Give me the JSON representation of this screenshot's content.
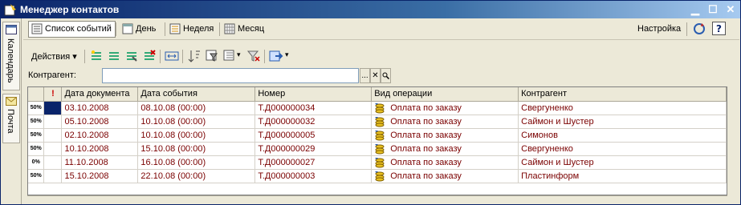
{
  "window": {
    "title": "Менеджер контактов"
  },
  "sidebar": {
    "tabs": [
      {
        "label": "Календарь"
      },
      {
        "label": "Почта"
      }
    ]
  },
  "toolbar": {
    "event_list": "Список событий",
    "day": "День",
    "week": "Неделя",
    "month": "Месяц",
    "settings": "Настройка"
  },
  "actions": {
    "label": "Действия"
  },
  "filter": {
    "label": "Контрагент:",
    "value": "",
    "select_btn": "...",
    "clear_btn": "✕"
  },
  "table": {
    "columns": [
      "Дата документа",
      "Дата события",
      "Номер",
      "Вид операции",
      "Контрагент"
    ],
    "rows": [
      {
        "ind": "50%",
        "doc_date": "03.10.2008",
        "event_date": "08.10.08 (00:00)",
        "number": "Т.Д000000034",
        "op": "Оплата по заказу",
        "partner": "Свергуненко"
      },
      {
        "ind": "50%",
        "doc_date": "05.10.2008",
        "event_date": "10.10.08 (00:00)",
        "number": "Т.Д000000032",
        "op": "Оплата по заказу",
        "partner": "Саймон и Шустер"
      },
      {
        "ind": "50%",
        "doc_date": "02.10.2008",
        "event_date": "10.10.08 (00:00)",
        "number": "Т.Д000000005",
        "op": "Оплата по заказу",
        "partner": "Симонов"
      },
      {
        "ind": "50%",
        "doc_date": "10.10.2008",
        "event_date": "15.10.08 (00:00)",
        "number": "Т.Д000000029",
        "op": "Оплата по заказу",
        "partner": "Свергуненко"
      },
      {
        "ind": "0%",
        "doc_date": "11.10.2008",
        "event_date": "16.10.08 (00:00)",
        "number": "Т.Д000000027",
        "op": "Оплата по заказу",
        "partner": "Саймон и Шустер"
      },
      {
        "ind": "50%",
        "doc_date": "15.10.2008",
        "event_date": "22.10.08 (00:00)",
        "number": "Т.Д000000003",
        "op": "Оплата по заказу",
        "partner": "Пластинформ"
      }
    ]
  },
  "colors": {
    "title_bar": "#0a246a",
    "row_text": "#7a0000",
    "selection": "#0a246a"
  }
}
